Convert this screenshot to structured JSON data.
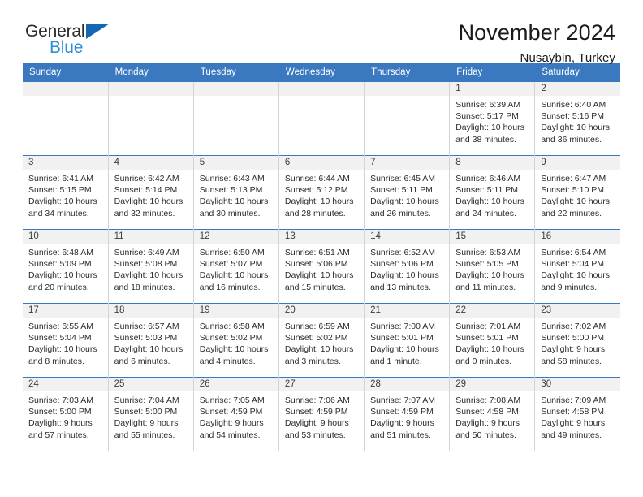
{
  "brand": {
    "name_part1": "General",
    "name_part2": "Blue",
    "triangle_icon": "triangle-icon",
    "accent_color": "#1268b3",
    "secondary_color": "#2e8fd4"
  },
  "header": {
    "title": "November 2024",
    "location": "Nusaybin, Turkey"
  },
  "theme": {
    "header_bg": "#3a78bf",
    "daynum_band_bg": "#f1f1f1",
    "grid_line": "#d4d4d4",
    "text": "#2b2b2b"
  },
  "weekdays": [
    "Sunday",
    "Monday",
    "Tuesday",
    "Wednesday",
    "Thursday",
    "Friday",
    "Saturday"
  ],
  "weeks": [
    [
      {
        "day": "",
        "sunrise": "",
        "sunset": "",
        "daylight_line1": "",
        "daylight_line2": ""
      },
      {
        "day": "",
        "sunrise": "",
        "sunset": "",
        "daylight_line1": "",
        "daylight_line2": ""
      },
      {
        "day": "",
        "sunrise": "",
        "sunset": "",
        "daylight_line1": "",
        "daylight_line2": ""
      },
      {
        "day": "",
        "sunrise": "",
        "sunset": "",
        "daylight_line1": "",
        "daylight_line2": ""
      },
      {
        "day": "",
        "sunrise": "",
        "sunset": "",
        "daylight_line1": "",
        "daylight_line2": ""
      },
      {
        "day": "1",
        "sunrise": "Sunrise: 6:39 AM",
        "sunset": "Sunset: 5:17 PM",
        "daylight_line1": "Daylight: 10 hours",
        "daylight_line2": "and 38 minutes."
      },
      {
        "day": "2",
        "sunrise": "Sunrise: 6:40 AM",
        "sunset": "Sunset: 5:16 PM",
        "daylight_line1": "Daylight: 10 hours",
        "daylight_line2": "and 36 minutes."
      }
    ],
    [
      {
        "day": "3",
        "sunrise": "Sunrise: 6:41 AM",
        "sunset": "Sunset: 5:15 PM",
        "daylight_line1": "Daylight: 10 hours",
        "daylight_line2": "and 34 minutes."
      },
      {
        "day": "4",
        "sunrise": "Sunrise: 6:42 AM",
        "sunset": "Sunset: 5:14 PM",
        "daylight_line1": "Daylight: 10 hours",
        "daylight_line2": "and 32 minutes."
      },
      {
        "day": "5",
        "sunrise": "Sunrise: 6:43 AM",
        "sunset": "Sunset: 5:13 PM",
        "daylight_line1": "Daylight: 10 hours",
        "daylight_line2": "and 30 minutes."
      },
      {
        "day": "6",
        "sunrise": "Sunrise: 6:44 AM",
        "sunset": "Sunset: 5:12 PM",
        "daylight_line1": "Daylight: 10 hours",
        "daylight_line2": "and 28 minutes."
      },
      {
        "day": "7",
        "sunrise": "Sunrise: 6:45 AM",
        "sunset": "Sunset: 5:11 PM",
        "daylight_line1": "Daylight: 10 hours",
        "daylight_line2": "and 26 minutes."
      },
      {
        "day": "8",
        "sunrise": "Sunrise: 6:46 AM",
        "sunset": "Sunset: 5:11 PM",
        "daylight_line1": "Daylight: 10 hours",
        "daylight_line2": "and 24 minutes."
      },
      {
        "day": "9",
        "sunrise": "Sunrise: 6:47 AM",
        "sunset": "Sunset: 5:10 PM",
        "daylight_line1": "Daylight: 10 hours",
        "daylight_line2": "and 22 minutes."
      }
    ],
    [
      {
        "day": "10",
        "sunrise": "Sunrise: 6:48 AM",
        "sunset": "Sunset: 5:09 PM",
        "daylight_line1": "Daylight: 10 hours",
        "daylight_line2": "and 20 minutes."
      },
      {
        "day": "11",
        "sunrise": "Sunrise: 6:49 AM",
        "sunset": "Sunset: 5:08 PM",
        "daylight_line1": "Daylight: 10 hours",
        "daylight_line2": "and 18 minutes."
      },
      {
        "day": "12",
        "sunrise": "Sunrise: 6:50 AM",
        "sunset": "Sunset: 5:07 PM",
        "daylight_line1": "Daylight: 10 hours",
        "daylight_line2": "and 16 minutes."
      },
      {
        "day": "13",
        "sunrise": "Sunrise: 6:51 AM",
        "sunset": "Sunset: 5:06 PM",
        "daylight_line1": "Daylight: 10 hours",
        "daylight_line2": "and 15 minutes."
      },
      {
        "day": "14",
        "sunrise": "Sunrise: 6:52 AM",
        "sunset": "Sunset: 5:06 PM",
        "daylight_line1": "Daylight: 10 hours",
        "daylight_line2": "and 13 minutes."
      },
      {
        "day": "15",
        "sunrise": "Sunrise: 6:53 AM",
        "sunset": "Sunset: 5:05 PM",
        "daylight_line1": "Daylight: 10 hours",
        "daylight_line2": "and 11 minutes."
      },
      {
        "day": "16",
        "sunrise": "Sunrise: 6:54 AM",
        "sunset": "Sunset: 5:04 PM",
        "daylight_line1": "Daylight: 10 hours",
        "daylight_line2": "and 9 minutes."
      }
    ],
    [
      {
        "day": "17",
        "sunrise": "Sunrise: 6:55 AM",
        "sunset": "Sunset: 5:04 PM",
        "daylight_line1": "Daylight: 10 hours",
        "daylight_line2": "and 8 minutes."
      },
      {
        "day": "18",
        "sunrise": "Sunrise: 6:57 AM",
        "sunset": "Sunset: 5:03 PM",
        "daylight_line1": "Daylight: 10 hours",
        "daylight_line2": "and 6 minutes."
      },
      {
        "day": "19",
        "sunrise": "Sunrise: 6:58 AM",
        "sunset": "Sunset: 5:02 PM",
        "daylight_line1": "Daylight: 10 hours",
        "daylight_line2": "and 4 minutes."
      },
      {
        "day": "20",
        "sunrise": "Sunrise: 6:59 AM",
        "sunset": "Sunset: 5:02 PM",
        "daylight_line1": "Daylight: 10 hours",
        "daylight_line2": "and 3 minutes."
      },
      {
        "day": "21",
        "sunrise": "Sunrise: 7:00 AM",
        "sunset": "Sunset: 5:01 PM",
        "daylight_line1": "Daylight: 10 hours",
        "daylight_line2": "and 1 minute."
      },
      {
        "day": "22",
        "sunrise": "Sunrise: 7:01 AM",
        "sunset": "Sunset: 5:01 PM",
        "daylight_line1": "Daylight: 10 hours",
        "daylight_line2": "and 0 minutes."
      },
      {
        "day": "23",
        "sunrise": "Sunrise: 7:02 AM",
        "sunset": "Sunset: 5:00 PM",
        "daylight_line1": "Daylight: 9 hours",
        "daylight_line2": "and 58 minutes."
      }
    ],
    [
      {
        "day": "24",
        "sunrise": "Sunrise: 7:03 AM",
        "sunset": "Sunset: 5:00 PM",
        "daylight_line1": "Daylight: 9 hours",
        "daylight_line2": "and 57 minutes."
      },
      {
        "day": "25",
        "sunrise": "Sunrise: 7:04 AM",
        "sunset": "Sunset: 5:00 PM",
        "daylight_line1": "Daylight: 9 hours",
        "daylight_line2": "and 55 minutes."
      },
      {
        "day": "26",
        "sunrise": "Sunrise: 7:05 AM",
        "sunset": "Sunset: 4:59 PM",
        "daylight_line1": "Daylight: 9 hours",
        "daylight_line2": "and 54 minutes."
      },
      {
        "day": "27",
        "sunrise": "Sunrise: 7:06 AM",
        "sunset": "Sunset: 4:59 PM",
        "daylight_line1": "Daylight: 9 hours",
        "daylight_line2": "and 53 minutes."
      },
      {
        "day": "28",
        "sunrise": "Sunrise: 7:07 AM",
        "sunset": "Sunset: 4:59 PM",
        "daylight_line1": "Daylight: 9 hours",
        "daylight_line2": "and 51 minutes."
      },
      {
        "day": "29",
        "sunrise": "Sunrise: 7:08 AM",
        "sunset": "Sunset: 4:58 PM",
        "daylight_line1": "Daylight: 9 hours",
        "daylight_line2": "and 50 minutes."
      },
      {
        "day": "30",
        "sunrise": "Sunrise: 7:09 AM",
        "sunset": "Sunset: 4:58 PM",
        "daylight_line1": "Daylight: 9 hours",
        "daylight_line2": "and 49 minutes."
      }
    ]
  ]
}
